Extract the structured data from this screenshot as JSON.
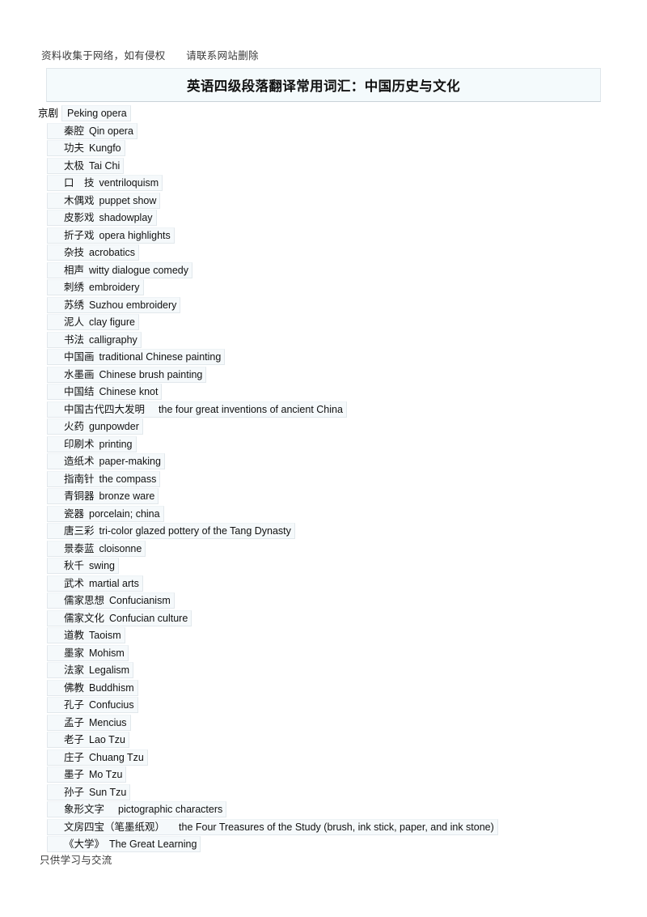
{
  "document": {
    "watermark_top": "资料收集于网络，如有侵权　　请联系网站删除",
    "title": "英语四级段落翻译常用词汇：中国历史与文化",
    "watermark_bottom": "只供学习与交流",
    "colors": {
      "banner_fill": "#f4fafc",
      "banner_border": "#dfe6ea",
      "row_fill": "#f5f9fb",
      "row_border": "#e2e8ec",
      "text": "#111111",
      "watermark_text": "#3a3a3a",
      "page_background": "#ffffff"
    }
  },
  "entries": [
    {
      "cn": "京剧",
      "en": "Peking opera",
      "first": true,
      "wide_gap": false
    },
    {
      "cn": "秦腔",
      "en": "Qin opera",
      "first": false,
      "wide_gap": false
    },
    {
      "cn": "功夫",
      "en": "Kungfo",
      "first": false,
      "wide_gap": false
    },
    {
      "cn": "太极",
      "en": "Tai Chi",
      "first": false,
      "wide_gap": false
    },
    {
      "cn": "口　技",
      "en": "ventriloquism",
      "first": false,
      "wide_gap": false
    },
    {
      "cn": "木偶戏",
      "en": "puppet show",
      "first": false,
      "wide_gap": false
    },
    {
      "cn": "皮影戏",
      "en": "shadowplay",
      "first": false,
      "wide_gap": false
    },
    {
      "cn": "折子戏",
      "en": "opera highlights",
      "first": false,
      "wide_gap": false
    },
    {
      "cn": "杂技",
      "en": "acrobatics",
      "first": false,
      "wide_gap": false
    },
    {
      "cn": "相声",
      "en": "witty dialogue comedy",
      "first": false,
      "wide_gap": false
    },
    {
      "cn": "刺绣",
      "en": "embroidery",
      "first": false,
      "wide_gap": false
    },
    {
      "cn": "苏绣",
      "en": "Suzhou embroidery",
      "first": false,
      "wide_gap": false
    },
    {
      "cn": "泥人",
      "en": "clay figure",
      "first": false,
      "wide_gap": false
    },
    {
      "cn": "书法",
      "en": "calligraphy",
      "first": false,
      "wide_gap": false
    },
    {
      "cn": "中国画",
      "en": "traditional Chinese painting",
      "first": false,
      "wide_gap": false
    },
    {
      "cn": "水墨画",
      "en": "Chinese brush painting",
      "first": false,
      "wide_gap": false
    },
    {
      "cn": "中国结",
      "en": "Chinese knot",
      "first": false,
      "wide_gap": false
    },
    {
      "cn": "中国古代四大发明",
      "en": "the four great inventions of ancient China",
      "first": false,
      "wide_gap": true
    },
    {
      "cn": "火药",
      "en": "gunpowder",
      "first": false,
      "wide_gap": false
    },
    {
      "cn": "印刷术",
      "en": "printing",
      "first": false,
      "wide_gap": false
    },
    {
      "cn": "造纸术",
      "en": "paper-making",
      "first": false,
      "wide_gap": false
    },
    {
      "cn": "指南针",
      "en": "the compass",
      "first": false,
      "wide_gap": false
    },
    {
      "cn": "青铜器",
      "en": "bronze ware",
      "first": false,
      "wide_gap": false
    },
    {
      "cn": "瓷器",
      "en": "porcelain; china",
      "first": false,
      "wide_gap": false
    },
    {
      "cn": "唐三彩",
      "en": "tri-color glazed pottery of the Tang Dynasty",
      "first": false,
      "wide_gap": false
    },
    {
      "cn": "景泰蓝",
      "en": "cloisonne",
      "first": false,
      "wide_gap": false
    },
    {
      "cn": "秋千",
      "en": "swing",
      "first": false,
      "wide_gap": false
    },
    {
      "cn": "武术",
      "en": "martial arts",
      "first": false,
      "wide_gap": false
    },
    {
      "cn": "儒家思想",
      "en": "Confucianism",
      "first": false,
      "wide_gap": false
    },
    {
      "cn": "儒家文化",
      "en": "Confucian culture",
      "first": false,
      "wide_gap": false
    },
    {
      "cn": "道教",
      "en": "Taoism",
      "first": false,
      "wide_gap": false
    },
    {
      "cn": "墨家",
      "en": "Mohism",
      "first": false,
      "wide_gap": false
    },
    {
      "cn": "法家",
      "en": "Legalism",
      "first": false,
      "wide_gap": false
    },
    {
      "cn": "佛教",
      "en": "Buddhism",
      "first": false,
      "wide_gap": false
    },
    {
      "cn": "孔子",
      "en": "Confucius",
      "first": false,
      "wide_gap": false
    },
    {
      "cn": "孟子",
      "en": "Mencius",
      "first": false,
      "wide_gap": false
    },
    {
      "cn": "老子",
      "en": "Lao Tzu",
      "first": false,
      "wide_gap": false
    },
    {
      "cn": "庄子",
      "en": "Chuang Tzu",
      "first": false,
      "wide_gap": false
    },
    {
      "cn": "墨子",
      "en": "Mo Tzu",
      "first": false,
      "wide_gap": false
    },
    {
      "cn": "孙子",
      "en": "Sun Tzu",
      "first": false,
      "wide_gap": false
    },
    {
      "cn": "象形文字",
      "en": "pictographic characters",
      "first": false,
      "wide_gap": true
    },
    {
      "cn": "文房四宝（笔墨纸观）",
      "en": "the Four Treasures of the Study (brush, ink stick, paper, and ink stone)",
      "first": false,
      "wide_gap": true
    },
    {
      "cn": "《大学》",
      "en": "The Great Learning",
      "first": false,
      "wide_gap": false
    }
  ]
}
